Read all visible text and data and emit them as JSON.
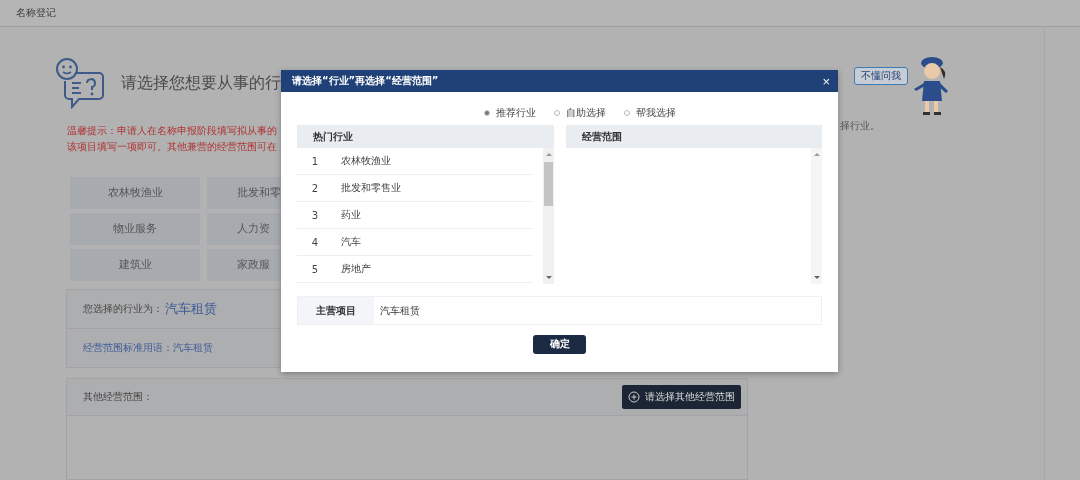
{
  "breadcrumb": "名称登记",
  "heading": "请选择您想要从事的行",
  "tips": [
    "温馨提示：申请人在名称申报阶段填写拟从事的",
    "该项目填写一项即可。其他兼营的经营范围可在"
  ],
  "side_note": "择行业。",
  "helper_bubble": "不懂问我",
  "industry_buttons": [
    [
      "农林牧渔业",
      "批发和零"
    ],
    [
      "物业服务",
      "人力资"
    ],
    [
      "建筑业",
      "家政服"
    ]
  ],
  "selected_industry": {
    "label": "您选择的行业为：",
    "value": "汽车租赁"
  },
  "standard_term": "经营范围标准用语：汽车租赁",
  "other_scope": {
    "label": "其他经营范围：",
    "button": "请选择其他经营范围"
  },
  "dialog": {
    "title": "请选择“行业”再选择“经营范围”",
    "close": "×",
    "modes": [
      {
        "label": "推荐行业",
        "selected": true
      },
      {
        "label": "自助选择",
        "selected": false
      },
      {
        "label": "帮我选择",
        "selected": false
      }
    ],
    "industries": {
      "heading": "热门行业",
      "rows": [
        {
          "index": "1",
          "name": "农林牧渔业"
        },
        {
          "index": "2",
          "name": "批发和零售业"
        },
        {
          "index": "3",
          "name": "药业"
        },
        {
          "index": "4",
          "name": "汽车"
        },
        {
          "index": "5",
          "name": "房地产"
        }
      ]
    },
    "scope": {
      "heading": "经营范围"
    },
    "main_item": {
      "label": "主营项目",
      "value": "汽车租赁"
    },
    "confirm": "确定"
  }
}
